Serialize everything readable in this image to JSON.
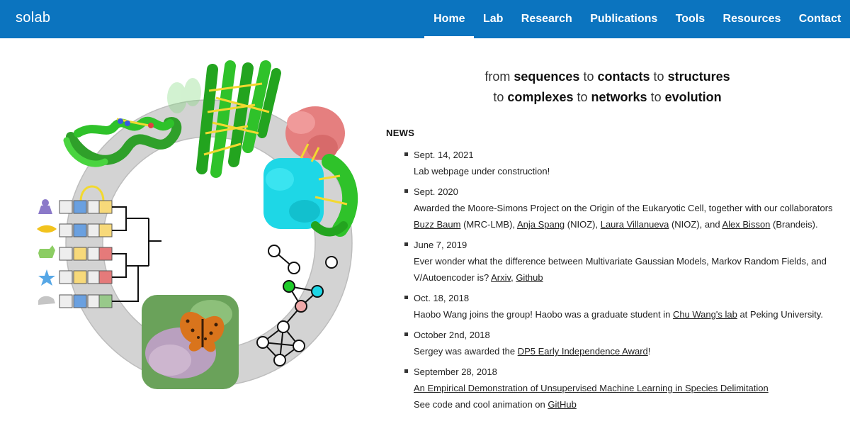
{
  "site": {
    "brand": "solab"
  },
  "nav": {
    "items": [
      {
        "label": "Home",
        "active": true
      },
      {
        "label": "Lab"
      },
      {
        "label": "Research"
      },
      {
        "label": "Publications"
      },
      {
        "label": "Tools"
      },
      {
        "label": "Resources"
      },
      {
        "label": "Contact"
      }
    ]
  },
  "tagline": {
    "line1": {
      "w1": "from",
      "w2": "sequences",
      "w3": "to",
      "w4": "contacts",
      "w5": "to",
      "w6": "structures"
    },
    "line2": {
      "w1": "to",
      "w2": "complexes",
      "w3": "to",
      "w4": "networks",
      "w5": "to",
      "w6": "evolution"
    }
  },
  "news": {
    "heading": "NEWS",
    "items": [
      {
        "date": "Sept. 14, 2021",
        "text": "Lab webpage under construction!"
      },
      {
        "date": "Sept. 2020",
        "t1": "Awarded the Moore-Simons Project on the Origin of the Eukaryotic Cell, together with our collaborators",
        "l1": "Buzz Baum",
        "t2": " (MRC-LMB), ",
        "l2": "Anja Spang",
        "t3": " (NIOZ), ",
        "l3": "Laura Villanueva",
        "t4": " (NIOZ), and ",
        "l4": "Alex Bisson",
        "t5": " (Brandeis)."
      },
      {
        "date": "June 7, 2019",
        "t1": "Ever wonder what the difference between Multivariate Gaussian Models, Markov Random Fields, and V/Autoencoder is? ",
        "l1": "Arxiv",
        "t2": ", ",
        "l2": "Github"
      },
      {
        "date": "Oct. 18, 2018",
        "t1": "Haobo Wang joins the group! Haobo was a graduate student in ",
        "l1": "Chu Wang's lab",
        "t2": " at Peking University."
      },
      {
        "date": "October 2nd, 2018",
        "t1": "Sergey was awarded the ",
        "l1": "DP5 Early Independence Award",
        "t2": "!"
      },
      {
        "date": "September 28, 2018",
        "l1": "An Empirical Demonstration of Unsupervised Machine Learning in Species Delimitation",
        "t1": "See code and cool animation on ",
        "l2": "GitHub"
      }
    ]
  },
  "colors": {
    "nav_bg": "#0b74bf",
    "protein_green": "#2fc22a",
    "protein_pink": "#e57f7f",
    "protein_cyan": "#1ed7e6",
    "helix_yellow": "#f2d930",
    "ring_gray": "#d3d3d3",
    "cell_blue": "#6aa0e0",
    "cell_yellow": "#f7d97a",
    "cell_red": "#e57a7a",
    "cell_green": "#98c98a"
  }
}
